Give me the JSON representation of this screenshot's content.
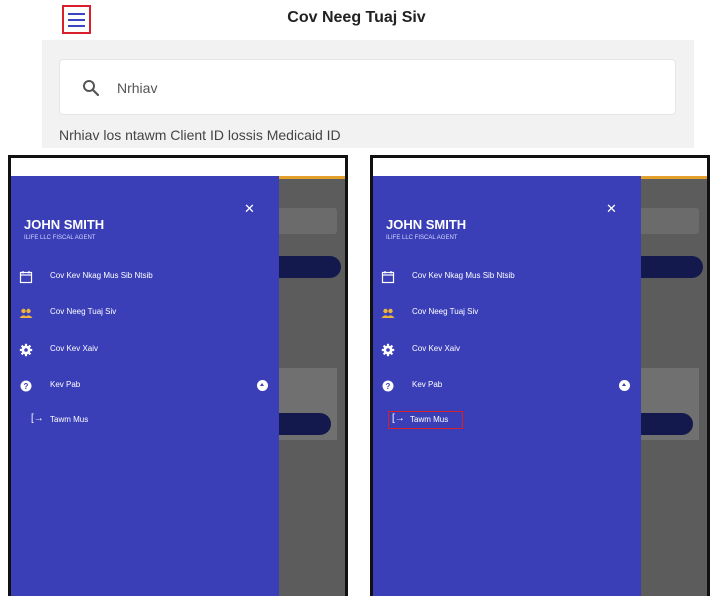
{
  "header": {
    "title": "Cov Neeg Tuaj Siv",
    "menu_icon": "hamburger-icon",
    "highlight_color": "#d8202c"
  },
  "search": {
    "value": "Nrhiav",
    "hint": "Nrhiav los ntawm Client ID lossis Medicaid ID",
    "icon": "search-icon"
  },
  "drawer": {
    "bg_color": "#3a3fb8",
    "user_name": "JOHN SMITH",
    "user_org": "ILIFE LLC FISCAL AGENT",
    "close_icon": "close-icon",
    "items": [
      {
        "label": "Cov Kev Nkag Mus Sib Ntsib",
        "icon": "calendar-icon"
      },
      {
        "label": "Cov Neeg Tuaj Siv",
        "icon": "people-icon"
      },
      {
        "label": "Cov Kev Xaiv",
        "icon": "gear-icon"
      },
      {
        "label": "Kev Pab",
        "icon": "help-icon"
      }
    ],
    "logout_label": "Tawm Mus",
    "logout_icon": "logout-icon"
  }
}
